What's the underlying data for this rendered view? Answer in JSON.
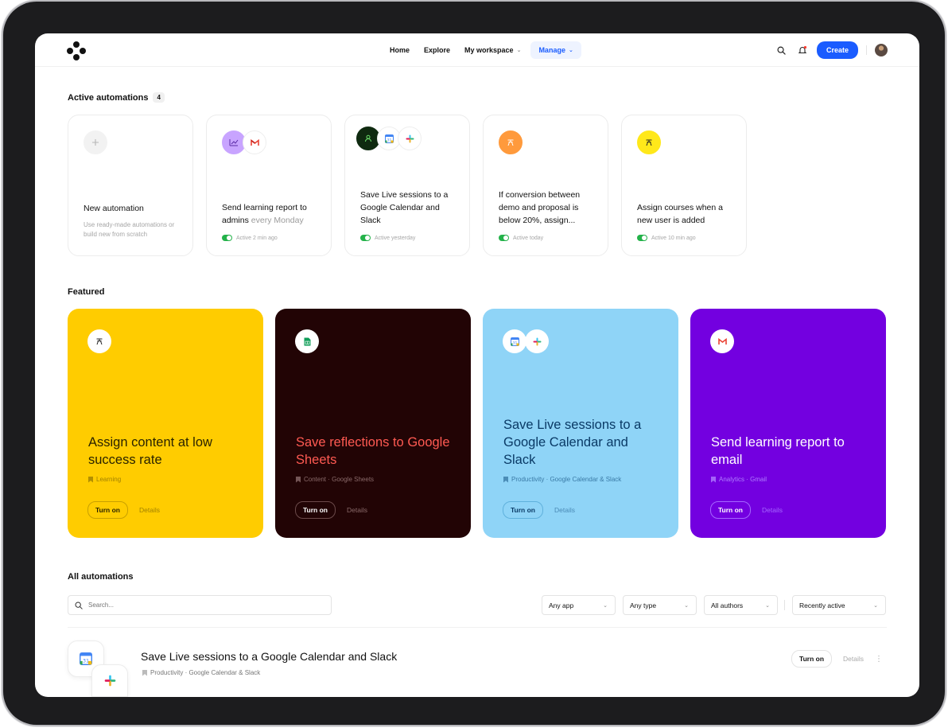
{
  "colors": {
    "accent": "#1a5cff",
    "active_toggle": "#24b24a",
    "featured_1_bg": "#ffcc00",
    "featured_2_bg": "#220405",
    "featured_2_text": "#ff5a52",
    "featured_3_bg": "#8fd4f7",
    "featured_3_text": "#0a3a66",
    "featured_4_bg": "#7300e0"
  },
  "nav": {
    "items": [
      {
        "label": "Home"
      },
      {
        "label": "Explore"
      },
      {
        "label": "My workspace"
      },
      {
        "label": "Manage"
      }
    ],
    "create_label": "Create"
  },
  "active": {
    "title": "Active automations",
    "count": "4",
    "new_card": {
      "title": "New automation",
      "desc": "Use ready-made automations or build new from scratch"
    },
    "cards": [
      {
        "title": "Send learning report to admins ",
        "title_muted": "every Monday",
        "status": "Active 2 min ago",
        "icons": [
          "chart-icon",
          "gmail-icon"
        ]
      },
      {
        "title": "Save Live sessions to a Google Calendar and Slack",
        "title_muted": "",
        "status": "Active yesterday",
        "icons": [
          "user-icon",
          "google-calendar-icon",
          "slack-icon"
        ]
      },
      {
        "title": "If conversion between demo and proposal is below 20%, assign...",
        "title_muted": "",
        "status": "Active today",
        "icons": [
          "assign-icon"
        ]
      },
      {
        "title": "Assign courses when a new user is added",
        "title_muted": "",
        "status": "Active 10 min ago",
        "icons": [
          "assign-icon"
        ]
      }
    ]
  },
  "featured": {
    "title": "Featured",
    "cards": [
      {
        "title": "Assign content at low success rate",
        "meta": "Learning",
        "turn_on": "Turn on",
        "details": "Details"
      },
      {
        "title": "Save reflections to Google Sheets",
        "meta": "Content · Google Sheets",
        "turn_on": "Turn on",
        "details": "Details"
      },
      {
        "title": "Save Live sessions to a Google Calendar and Slack",
        "meta": "Productivity · Google Calendar & Slack",
        "turn_on": "Turn on",
        "details": "Details"
      },
      {
        "title": "Send learning report to email",
        "meta": "Analytics · Gmail",
        "turn_on": "Turn on",
        "details": "Details"
      }
    ]
  },
  "all": {
    "title": "All automations",
    "search_placeholder": "Search...",
    "filters": [
      {
        "label": "Any app"
      },
      {
        "label": "Any type"
      },
      {
        "label": "All authors"
      },
      {
        "label": "Recently active"
      }
    ],
    "rows": [
      {
        "title": "Save Live sessions to a Google Calendar and Slack",
        "meta": "Productivity · Google Calendar & Slack",
        "turn_on": "Turn on",
        "details": "Details"
      }
    ]
  }
}
